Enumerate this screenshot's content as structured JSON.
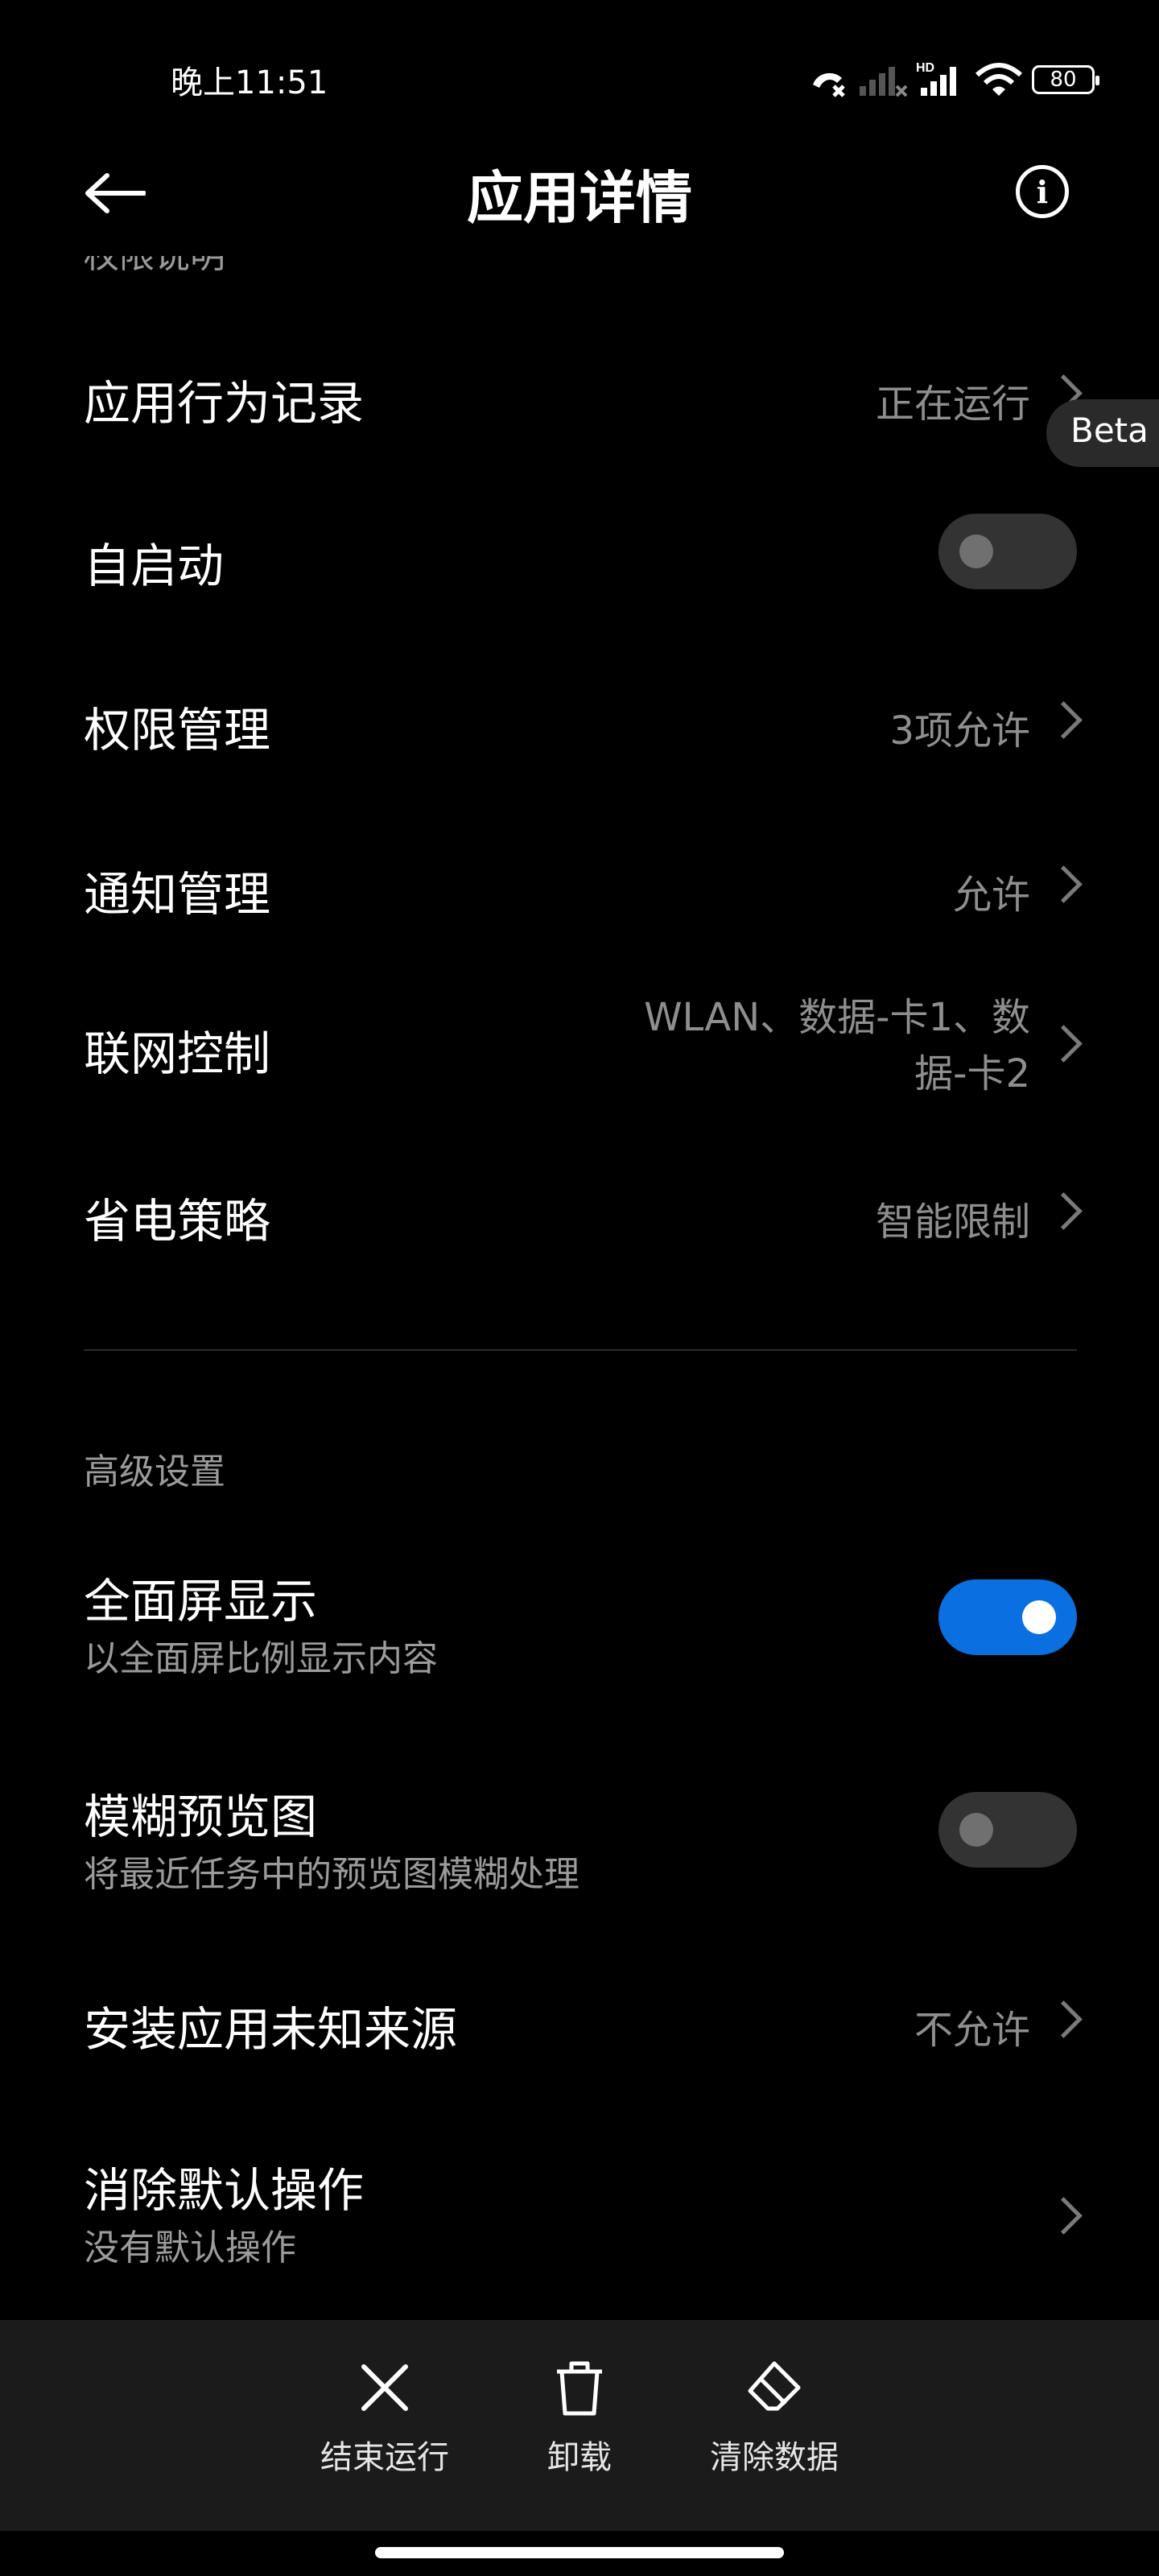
{
  "status_bar": {
    "time": "晚上11:51",
    "battery": "80",
    "icons": [
      "call-forwarding-icon",
      "signal-no-service-icon",
      "hd-signal-icon",
      "wifi-icon",
      "battery-icon"
    ]
  },
  "header": {
    "title": "应用详情",
    "back_icon": "back-arrow-icon",
    "info_icon": "info-icon",
    "info_glyph": "i"
  },
  "partial_text": "权限说明",
  "beta_label": "Beta",
  "rows": [
    {
      "title": "应用行为记录",
      "value": "正在运行",
      "type": "link"
    },
    {
      "title": "自启动",
      "type": "toggle",
      "checked": false
    },
    {
      "title": "权限管理",
      "value": "3项允许",
      "type": "link"
    },
    {
      "title": "通知管理",
      "value": "允许",
      "type": "link"
    },
    {
      "title": "联网控制",
      "value_line1": "WLAN、数据-卡1、数",
      "value_line2": "据-卡2",
      "type": "link"
    },
    {
      "title": "省电策略",
      "value": "智能限制",
      "type": "link"
    }
  ],
  "advanced": {
    "header": "高级设置",
    "rows": [
      {
        "title": "全面屏显示",
        "subtitle": "以全面屏比例显示内容",
        "type": "toggle",
        "checked": true
      },
      {
        "title": "模糊预览图",
        "subtitle": "将最近任务中的预览图模糊处理",
        "type": "toggle",
        "checked": false
      },
      {
        "title": "安装应用未知来源",
        "value": "不允许",
        "type": "link"
      },
      {
        "title": "消除默认操作",
        "subtitle": "没有默认操作",
        "type": "link"
      }
    ]
  },
  "bottom_actions": [
    {
      "label": "结束运行",
      "icon": "close-icon"
    },
    {
      "label": "卸载",
      "icon": "trash-icon"
    },
    {
      "label": "清除数据",
      "icon": "eraser-icon"
    }
  ],
  "colors": {
    "background": "#000000",
    "toggle_on": "#0a6fe0",
    "toggle_off": "#333333",
    "secondary_text": "#8e8e8e",
    "bottom_bar": "#1b1b1b"
  }
}
